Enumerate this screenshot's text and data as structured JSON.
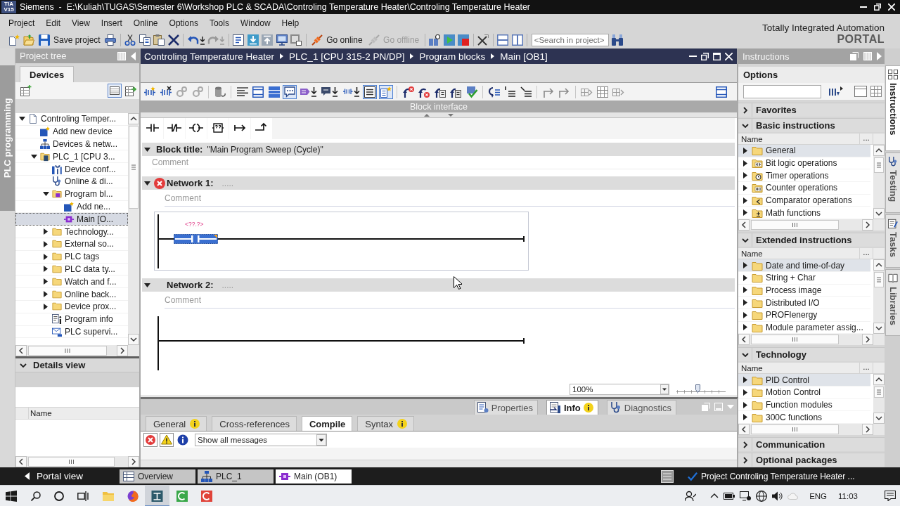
{
  "window": {
    "logo": "TIA V15",
    "title": "Siemens  -  E:\\Kuliah\\TUGAS\\Semester 6\\Workshop PLC & SCADA\\Controling Temperature Heater\\Controling Temperature Heater"
  },
  "menu": [
    "Project",
    "Edit",
    "View",
    "Insert",
    "Online",
    "Options",
    "Tools",
    "Window",
    "Help"
  ],
  "toolbar": {
    "save": "Save project",
    "go_online": {
      "label": "Go online",
      "disabled": false
    },
    "go_offline": {
      "label": "Go offline",
      "disabled": true
    },
    "search": {
      "placeholder": "<Search in project>"
    }
  },
  "brand": {
    "name": "Totally Integrated Automation",
    "product": "PORTAL"
  },
  "left_tabs": [
    {
      "label": "PLC programming",
      "selected": true
    }
  ],
  "project_tree": {
    "title": "Project tree",
    "tabs": [
      {
        "label": "Devices",
        "selected": true
      }
    ],
    "items": [
      {
        "label": "Controling Temper...",
        "kind": "project",
        "expanded": true,
        "selected": false,
        "children": [
          {
            "label": "Add new device",
            "kind": "add",
            "selected": false
          },
          {
            "label": "Devices & netw...",
            "kind": "network",
            "selected": false
          },
          {
            "label": "PLC_1 [CPU 3...",
            "kind": "plc",
            "expanded": true,
            "selected": false,
            "children": [
              {
                "label": "Device conf...",
                "kind": "config",
                "selected": false
              },
              {
                "label": "Online & di...",
                "kind": "online",
                "selected": false
              },
              {
                "label": "Program bl...",
                "kind": "blocks",
                "expanded": true,
                "selected": false,
                "children": [
                  {
                    "label": "Add ne...",
                    "kind": "add",
                    "selected": false
                  },
                  {
                    "label": "Main [O...",
                    "kind": "block",
                    "selected": true
                  }
                ]
              },
              {
                "label": "Technology...",
                "kind": "folder",
                "expanded": false,
                "selected": false
              },
              {
                "label": "External so...",
                "kind": "folder",
                "expanded": false,
                "selected": false
              },
              {
                "label": "PLC tags",
                "kind": "folder",
                "expanded": false,
                "selected": false
              },
              {
                "label": "PLC data ty...",
                "kind": "folder",
                "expanded": false,
                "selected": false
              },
              {
                "label": "Watch and f...",
                "kind": "folder",
                "expanded": false,
                "selected": false
              },
              {
                "label": "Online back...",
                "kind": "folder",
                "expanded": false,
                "selected": false
              },
              {
                "label": "Device prox...",
                "kind": "folder",
                "expanded": false,
                "selected": false
              },
              {
                "label": "Program info",
                "kind": "info",
                "selected": false
              },
              {
                "label": "PLC supervi...",
                "kind": "supervision",
                "selected": false
              }
            ]
          }
        ]
      }
    ]
  },
  "details_view": {
    "title": "Details view",
    "expanded": true,
    "columns": [
      "Name"
    ]
  },
  "editor": {
    "breadcrumb": [
      "Controling Temperature Heater",
      "PLC_1 [CPU 315-2 PN/DP]",
      "Program blocks",
      "Main [OB1]"
    ],
    "toolbar": [
      {
        "on": false
      },
      {
        "on": false
      },
      {
        "on": false
      },
      {
        "on": false
      },
      {
        "on": false
      },
      {
        "on": false
      },
      {
        "on": false
      },
      {
        "on": false
      },
      {
        "on": true
      },
      {
        "on": false
      },
      {
        "on": false
      },
      {
        "on": false
      },
      {
        "on": true
      },
      {
        "on": true
      },
      {
        "on": false
      },
      {
        "on": false
      },
      {
        "on": false
      },
      {
        "on": false
      },
      {
        "on": false
      },
      {
        "on": false
      },
      {
        "on": false
      },
      {
        "on": false
      },
      {
        "on": false
      },
      {
        "on": false
      },
      {
        "on": false
      },
      {
        "on": false
      },
      {
        "on": false
      }
    ],
    "interface_label": "Block interface",
    "block_title": {
      "label": "Block title:",
      "value": "\"Main Program Sweep (Cycle)\"",
      "expanded": true,
      "comment": {
        "placeholder": "Comment"
      }
    },
    "networks": [
      {
        "title": "Network 1:",
        "title_field": {
          "placeholder": "....."
        },
        "error": true,
        "expanded": true,
        "selected": true,
        "comment": {
          "placeholder": "Comment"
        },
        "elements": [
          {
            "kind": "contact",
            "operand": "<??.?>",
            "selected": true
          }
        ]
      },
      {
        "title": "Network 2:",
        "title_field": {
          "placeholder": "....."
        },
        "error": false,
        "expanded": true,
        "selected": false,
        "comment": {
          "placeholder": "Comment"
        }
      }
    ],
    "zoom": {
      "value": "100%",
      "level": 0.43
    }
  },
  "inspector": {
    "tabs": [
      {
        "label": "Properties",
        "kind": "properties",
        "selected": false,
        "info": false
      },
      {
        "label": "Info",
        "kind": "info",
        "selected": true,
        "info": true
      },
      {
        "label": "Diagnostics",
        "kind": "diagnostics",
        "selected": false,
        "info": false
      }
    ],
    "subtabs": [
      {
        "label": "General",
        "selected": false,
        "info": true
      },
      {
        "label": "Cross-references",
        "selected": false,
        "info": false
      },
      {
        "label": "Compile",
        "selected": true,
        "info": false
      },
      {
        "label": "Syntax",
        "selected": false,
        "info": true
      }
    ],
    "filters": [
      {
        "kind": "error",
        "on": true
      },
      {
        "kind": "warning",
        "on": true
      },
      {
        "kind": "info",
        "on": false
      }
    ],
    "message_filter": "Show all messages"
  },
  "instructions": {
    "title": "Instructions",
    "options": "Options",
    "sections": [
      {
        "title": "Favorites",
        "expanded": false
      },
      {
        "title": "Basic instructions",
        "expanded": true,
        "columns": [
          "Name",
          "..."
        ],
        "items": [
          {
            "label": "General",
            "kind": "folder",
            "selected": true,
            "expanded": false
          },
          {
            "label": "Bit logic operations",
            "kind": "bits",
            "selected": false,
            "expanded": false
          },
          {
            "label": "Timer operations",
            "kind": "timer",
            "selected": false,
            "expanded": false
          },
          {
            "label": "Counter operations",
            "kind": "counter",
            "selected": false,
            "expanded": false
          },
          {
            "label": "Comparator operations",
            "kind": "compare",
            "selected": false,
            "expanded": false
          },
          {
            "label": "Math functions",
            "kind": "math",
            "selected": false,
            "expanded": false
          }
        ]
      },
      {
        "title": "Extended instructions",
        "expanded": true,
        "columns": [
          "Name",
          "..."
        ],
        "items": [
          {
            "label": "Date and time-of-day",
            "kind": "folder",
            "selected": true,
            "expanded": false
          },
          {
            "label": "String + Char",
            "kind": "folder",
            "selected": false,
            "expanded": false
          },
          {
            "label": "Process image",
            "kind": "folder",
            "selected": false,
            "expanded": false
          },
          {
            "label": "Distributed I/O",
            "kind": "folder",
            "selected": false,
            "expanded": false
          },
          {
            "label": "PROFIenergy",
            "kind": "folder",
            "selected": false,
            "expanded": false
          },
          {
            "label": "Module parameter assig...",
            "kind": "folder",
            "selected": false,
            "expanded": false
          }
        ]
      },
      {
        "title": "Technology",
        "expanded": true,
        "columns": [
          "Name",
          "..."
        ],
        "items": [
          {
            "label": "PID Control",
            "kind": "folder",
            "selected": true,
            "expanded": false
          },
          {
            "label": "Motion Control",
            "kind": "folder",
            "selected": false,
            "expanded": false
          },
          {
            "label": "Function modules",
            "kind": "folder",
            "selected": false,
            "expanded": false
          },
          {
            "label": "300C functions",
            "kind": "folder",
            "selected": false,
            "expanded": false
          }
        ]
      },
      {
        "title": "Communication",
        "expanded": false
      },
      {
        "title": "Optional packages",
        "expanded": false
      }
    ]
  },
  "right_tabs": [
    {
      "label": "Instructions",
      "kind": "instructions",
      "selected": true
    },
    {
      "label": "Testing",
      "kind": "testing",
      "selected": false
    },
    {
      "label": "Tasks",
      "kind": "tasks",
      "selected": false
    },
    {
      "label": "Libraries",
      "kind": "libraries",
      "selected": false
    }
  ],
  "portal_bar": {
    "portal_view": "Portal view",
    "tabs": [
      {
        "label": "Overview",
        "kind": "overview",
        "selected": false
      },
      {
        "label": "PLC_1",
        "kind": "device",
        "selected": false
      },
      {
        "label": "Main (OB1)",
        "kind": "block",
        "selected": true
      }
    ],
    "status": "Project Controling Temperature Heater ..."
  },
  "taskbar": {
    "apps": [
      {
        "kind": "files",
        "active": false
      },
      {
        "kind": "browser",
        "active": false
      },
      {
        "kind": "tia",
        "active": true
      },
      {
        "kind": "green",
        "active": false
      },
      {
        "kind": "red",
        "active": false
      }
    ],
    "language": "ENG",
    "time": "11:03"
  }
}
